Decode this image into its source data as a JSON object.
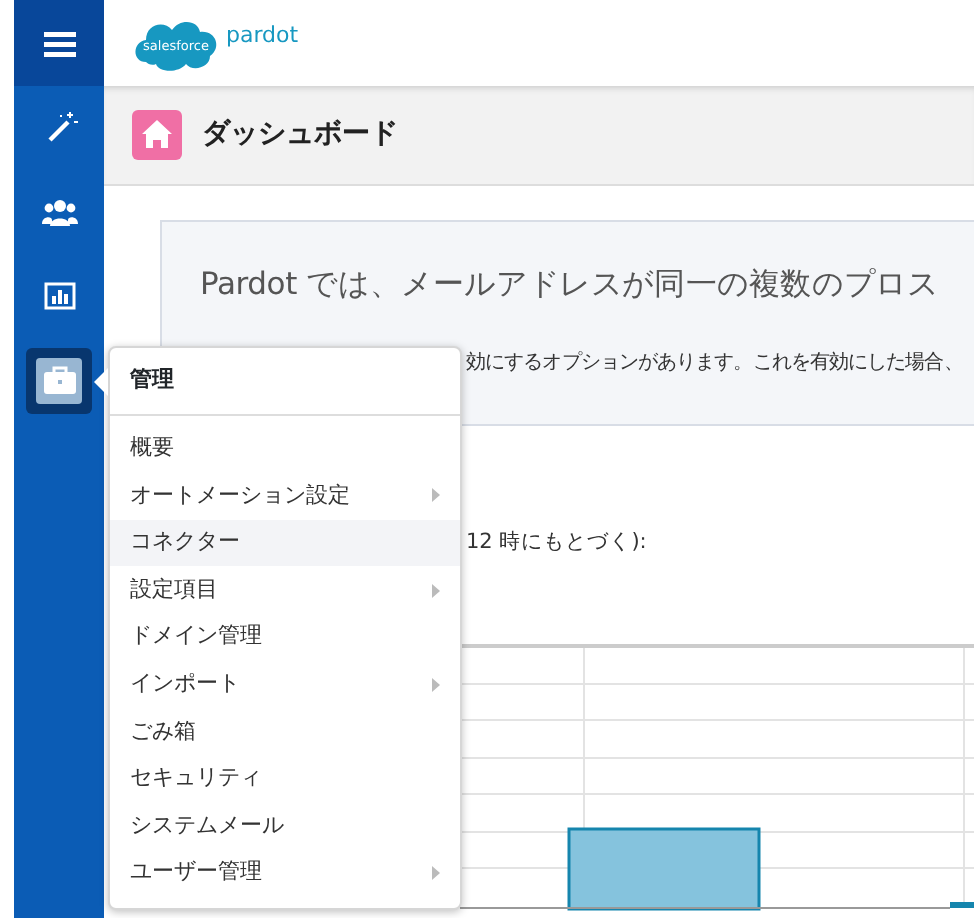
{
  "logo": {
    "cloud_text": "salesforce",
    "product": "pardot"
  },
  "sidebar": {
    "items": [
      {
        "kind": "menu",
        "selected": false
      },
      {
        "kind": "wand",
        "selected": false
      },
      {
        "kind": "people",
        "selected": false
      },
      {
        "kind": "report",
        "selected": false
      },
      {
        "kind": "briefcase",
        "selected": true
      }
    ]
  },
  "page_title": "ダッシュボード",
  "notice": {
    "heading": "Pardot では、メールアドレスが同一の複数のプロス",
    "body": "効にするオプションがあります。これを有効にした場合、"
  },
  "chart_caption": "12 時にもとづく):",
  "flyout": {
    "title": "管理",
    "items": [
      {
        "label": "概要",
        "has_submenu": false,
        "highlighted": false
      },
      {
        "label": "オートメーション設定",
        "has_submenu": true,
        "highlighted": false
      },
      {
        "label": "コネクター",
        "has_submenu": false,
        "highlighted": true
      },
      {
        "label": "設定項目",
        "has_submenu": true,
        "highlighted": false
      },
      {
        "label": "ドメイン管理",
        "has_submenu": false,
        "highlighted": false
      },
      {
        "label": "インポート",
        "has_submenu": true,
        "highlighted": false
      },
      {
        "label": "ごみ箱",
        "has_submenu": false,
        "highlighted": false
      },
      {
        "label": "セキュリティ",
        "has_submenu": false,
        "highlighted": false
      },
      {
        "label": "システムメール",
        "has_submenu": false,
        "highlighted": false
      },
      {
        "label": "ユーザー管理",
        "has_submenu": true,
        "highlighted": false
      }
    ]
  }
}
